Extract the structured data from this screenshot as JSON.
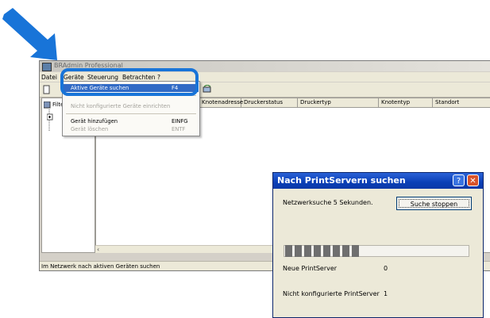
{
  "app": {
    "title": "BRAdmin Professional",
    "menu": [
      "Datei",
      "Geräte",
      "Steuerung",
      "Betrachten",
      "?"
    ],
    "tree_root": "Filter",
    "columns": [
      "Knotenadresse",
      "Druckerstatus",
      "Druckertyp",
      "Knotentyp",
      "Standort"
    ],
    "status": "Im Netzwerk nach aktiven Geräten suchen"
  },
  "dropdown": {
    "items": [
      {
        "label": "Aktive Geräte suchen",
        "key": "F4",
        "state": "selected"
      },
      {
        "label": "Nicht konfigurierte Geräte einrichten",
        "key": "",
        "state": "disabled"
      },
      {
        "label": "Gerät hinzufügen",
        "key": "EINFG",
        "state": "enabled"
      },
      {
        "label": "Gerät löschen",
        "key": "ENTF",
        "state": "disabled"
      }
    ]
  },
  "dialog": {
    "title": "Nach PrintServern suchen",
    "search_text": "Netzwerksuche 5 Sekunden.",
    "stop_button": "Suche stoppen",
    "progress_fraction": 0.45,
    "new_label": "Neue PrintServer",
    "new_count": "0",
    "unconfigured_label": "Nicht konfigurierte PrintServer",
    "unconfigured_count": "1"
  },
  "colors": {
    "pointer_arrow": "#1874d8",
    "highlight_ring": "#1874d8",
    "menu_selection": "#316ac5",
    "dialog_title": "#0a3fb6"
  }
}
